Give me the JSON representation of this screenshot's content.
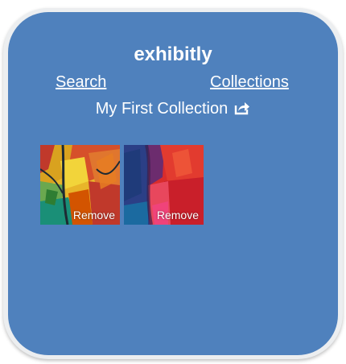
{
  "app": {
    "title": "exhibitly"
  },
  "nav": {
    "search_label": "Search",
    "collections_label": "Collections"
  },
  "collection": {
    "title": "My First Collection",
    "share_icon": "share-icon",
    "items": [
      {
        "remove_label": "Remove"
      },
      {
        "remove_label": "Remove"
      }
    ]
  },
  "colors": {
    "panel_background": "#4f81bd",
    "frame_background": "#eceef0",
    "text": "#ffffff"
  }
}
